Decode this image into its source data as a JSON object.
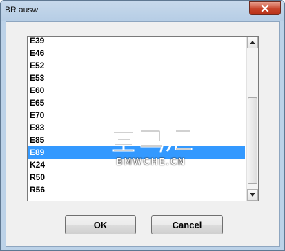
{
  "window": {
    "title": "BR ausw"
  },
  "list": {
    "items": [
      "E39",
      "E46",
      "E52",
      "E53",
      "E60",
      "E65",
      "E70",
      "E83",
      "E85",
      "E89",
      "K24",
      "R50",
      "R56"
    ],
    "selected_index": 9
  },
  "watermark": {
    "logo_text": "宝马汇",
    "url_text": "BMWCHE.CN"
  },
  "buttons": {
    "ok_label": "OK",
    "cancel_label": "Cancel"
  },
  "colors": {
    "selection": "#3399ff",
    "close_button": "#c7432a"
  }
}
